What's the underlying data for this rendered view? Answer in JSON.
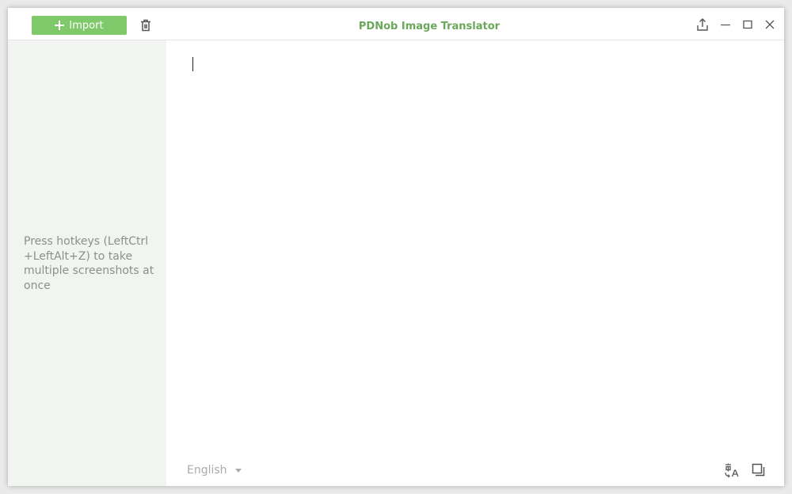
{
  "app": {
    "title": "PDNob Image Translator"
  },
  "toolbar": {
    "import_label": "Import",
    "icons": [
      "plus-icon",
      "trash-icon",
      "share-icon",
      "minimize-icon",
      "maximize-icon",
      "close-icon"
    ]
  },
  "sidebar": {
    "hint": "Press hotkeys (LeftCtrl +LeftAlt+Z) to take multiple screenshots at once"
  },
  "editor": {
    "text": ""
  },
  "bottom": {
    "language": "English",
    "icons": [
      "translate-icon",
      "copy-icon"
    ]
  },
  "colors": {
    "accent": "#7fc96a",
    "title": "#69a85a",
    "sidebar_bg": "#f2f4f2",
    "hint_text": "#8c8f8c"
  }
}
